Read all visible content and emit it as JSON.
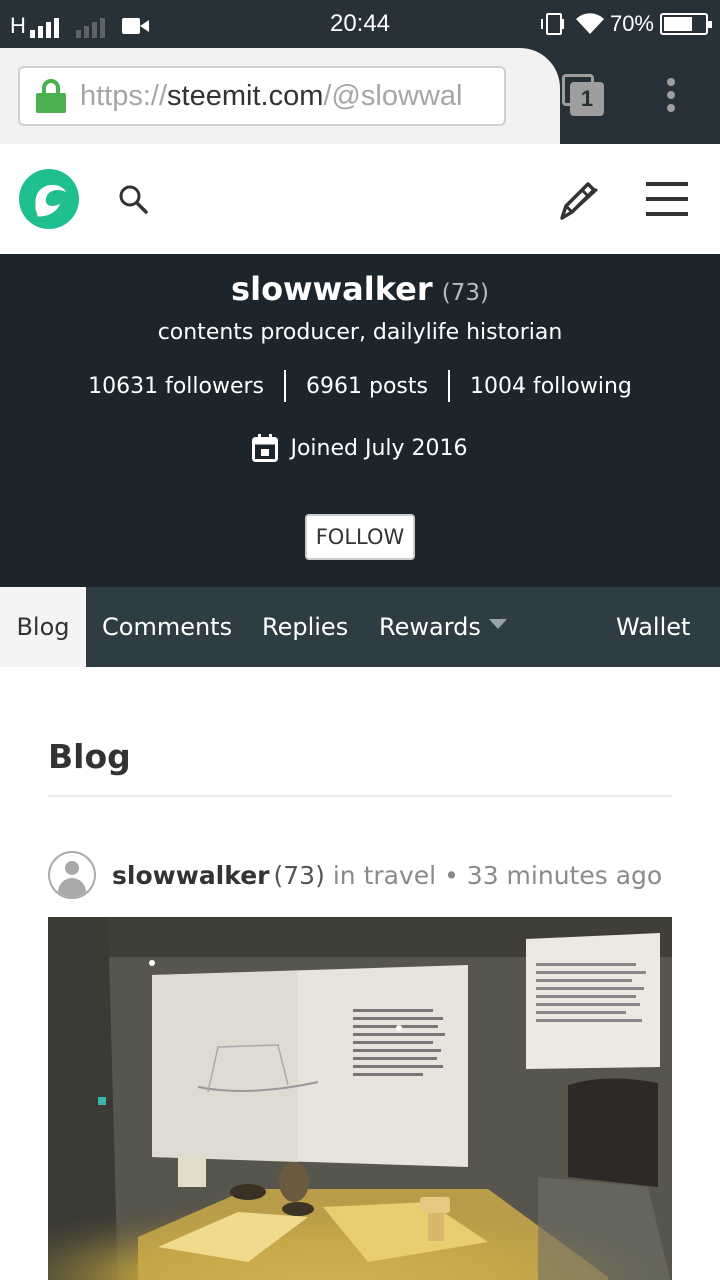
{
  "status_bar": {
    "network": "H",
    "time": "20:44",
    "battery_percent_label": "70%",
    "battery_level": 0.7
  },
  "browser": {
    "url_scheme": "https://",
    "url_host": "steemit.com",
    "url_path": "/@slowwal",
    "tab_count": "1"
  },
  "profile": {
    "username": "slowwalker",
    "reputation": "(73)",
    "about": "contents producer, dailylife historian",
    "followers": "10631 followers",
    "posts": "6961 posts",
    "following": "1004 following",
    "joined": "Joined July 2016",
    "follow_label": "FOLLOW"
  },
  "tabs": [
    {
      "label": "Blog",
      "active": true
    },
    {
      "label": "Comments"
    },
    {
      "label": "Replies"
    },
    {
      "label": "Rewards"
    },
    {
      "label": "Wallet"
    }
  ],
  "content": {
    "heading": "Blog",
    "post": {
      "author": "slowwalker",
      "author_rep": "(73)",
      "category": "in travel",
      "time": "• 33 minutes ago"
    }
  },
  "colors": {
    "statusbar": "#263238",
    "banner": "#1c252b",
    "tabs_bar": "#2e3d44",
    "brand_teal": "#1fbf8f",
    "lock_green": "#4caf50"
  }
}
